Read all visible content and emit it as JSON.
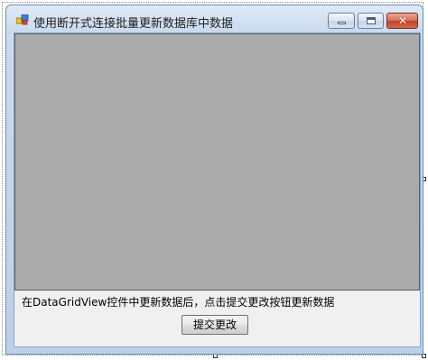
{
  "window": {
    "title": "使用断开式连接批量更新数据库中数据",
    "icon": "form-app-icon",
    "controls": {
      "minimize_icon": "minimize-icon",
      "maximize_icon": "maximize-icon",
      "close_icon": "close-icon",
      "close_glyph": "✕"
    }
  },
  "main": {
    "hint_text": "在DataGridView控件中更新数据后，点击提交更改按钮更新数据",
    "submit_button_label": "提交更改"
  },
  "colors": {
    "grid_background": "#ababab",
    "client_background": "#f0f0f0",
    "close_button": "#c2412a"
  }
}
